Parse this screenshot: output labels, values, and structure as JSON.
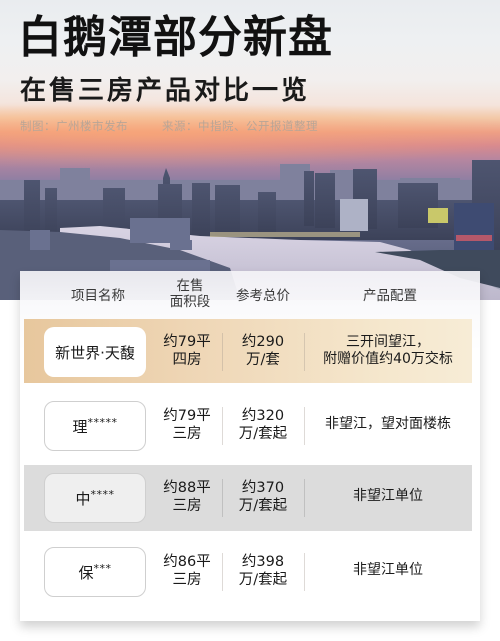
{
  "header": {
    "title": "白鹅潭部分新盘",
    "subtitle": "在售三房产品对比一览",
    "credit_producer": "制图：广州楼市发布",
    "credit_source": "来源：中指院、公开报道整理"
  },
  "background": {
    "image": "guangzhou-riverside-skyline-at-dusk",
    "colors": {
      "sky_top": "#eceef0",
      "sunset": "#ee9f86",
      "dusk": "#7a7a9c"
    }
  },
  "table": {
    "columns": {
      "name": "项目名称",
      "area_line1": "在售",
      "area_line2": "面积段",
      "price": "参考总价",
      "config": "产品配置"
    },
    "rows": [
      {
        "name": "新世界·天馥",
        "name_suffix": "",
        "area_line1": "约79平",
        "area_line2": "四房",
        "price_line1": "约290",
        "price_line2": "万/套",
        "config_line1": "三开间望江，",
        "config_line2": "附赠价值约40万交标",
        "style": "featured"
      },
      {
        "name": "理",
        "name_suffix": "*****",
        "area_line1": "约79平",
        "area_line2": "三房",
        "price_line1": "约320",
        "price_line2": "万/套起",
        "config_line1": "非望江，望对面楼栋",
        "config_line2": "",
        "style": "plain"
      },
      {
        "name": "中",
        "name_suffix": "****",
        "area_line1": "约88平",
        "area_line2": "三房",
        "price_line1": "约370",
        "price_line2": "万/套起",
        "config_line1": "非望江单位",
        "config_line2": "",
        "style": "gray"
      },
      {
        "name": "保",
        "name_suffix": "***",
        "area_line1": "约86平",
        "area_line2": "三房",
        "price_line1": "约398",
        "price_line2": "万/套起",
        "config_line1": "非望江单位",
        "config_line2": "",
        "style": "plain"
      }
    ],
    "colors": {
      "featured_row": "#efd7b7",
      "gray_row": "#dcdcdc",
      "text": "#1a1a1a"
    }
  }
}
